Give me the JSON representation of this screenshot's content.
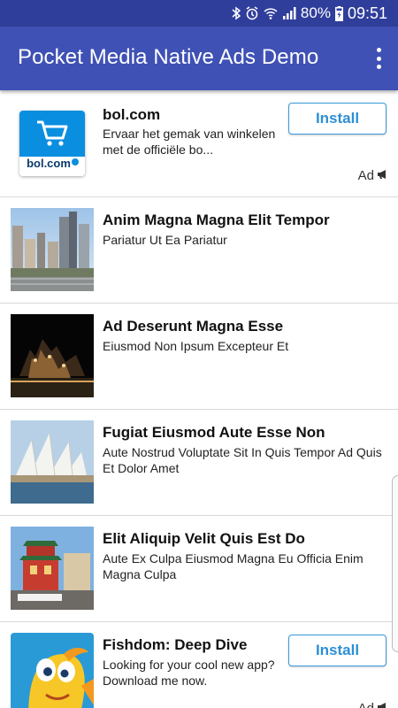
{
  "status_bar": {
    "battery": "80%",
    "time": "09:51",
    "icons": [
      "bluetooth-icon",
      "alarm-icon",
      "wifi-icon",
      "signal-icon",
      "battery-icon"
    ]
  },
  "app_bar": {
    "title": "Pocket Media Native Ads Demo",
    "menu_icon": "more-vert-icon"
  },
  "feed": [
    {
      "type": "ad",
      "title": "bol.com",
      "description": "Ervaar het gemak van winkelen met de officiële bo...",
      "button": "Install",
      "ad_label": "Ad",
      "thumb": "bol-logo"
    },
    {
      "type": "item",
      "title": "Anim Magna Magna Elit Tempor",
      "description": "Pariatur Ut Ea Pariatur",
      "thumb": "city-photo"
    },
    {
      "type": "item",
      "title": "Ad Deserunt Magna Esse",
      "description": "Eiusmod Non Ipsum Excepteur Et",
      "thumb": "night-hotel-photo"
    },
    {
      "type": "item",
      "title": "Fugiat Eiusmod Aute Esse Non",
      "description": "Aute Nostrud Voluptate Sit In Quis Tempor Ad Quis Et Dolor Amet",
      "thumb": "opera-house-photo"
    },
    {
      "type": "item",
      "title": "Elit Aliquip Velit Quis Est Do",
      "description": "Aute Ex Culpa Eiusmod Magna Eu Officia Enim Magna Culpa",
      "thumb": "chinatown-gate-photo"
    },
    {
      "type": "ad",
      "title": "Fishdom: Deep Dive",
      "description": "Looking for your cool new app? Download me now.",
      "button": "Install",
      "ad_label": "Ad",
      "thumb": "fish-character"
    }
  ],
  "colors": {
    "status_bar": "#303e9b",
    "app_bar": "#3f51b5",
    "install_button": "#2d8fd5",
    "bol_blue": "#0a8ee0"
  }
}
